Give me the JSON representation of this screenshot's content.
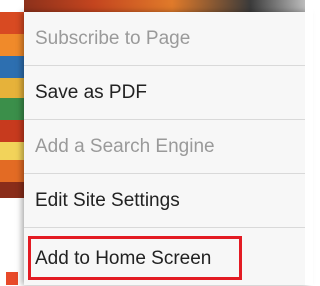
{
  "menu": {
    "items": [
      {
        "label": "Subscribe to Page",
        "enabled": false
      },
      {
        "label": "Save as PDF",
        "enabled": true
      },
      {
        "label": "Add a Search Engine",
        "enabled": false
      },
      {
        "label": "Edit Site Settings",
        "enabled": true
      },
      {
        "label": "Add to Home Screen",
        "enabled": true,
        "highlighted": true
      }
    ]
  },
  "colors": {
    "highlight_border": "#e31b23",
    "disabled_text": "#9a9a9a",
    "menu_background": "#f7f7f7"
  }
}
